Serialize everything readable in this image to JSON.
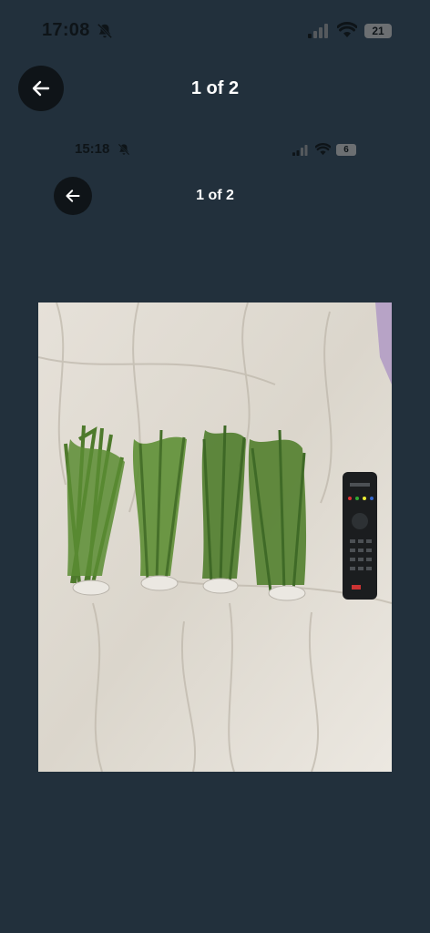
{
  "status_bar": {
    "time": "17:08",
    "battery": "21"
  },
  "header": {
    "page_counter": "1 of 2"
  },
  "inner_screenshot": {
    "status_bar": {
      "time": "15:18",
      "battery": "6"
    },
    "page_counter": "1 of 2"
  },
  "icons": {
    "back": "arrow-left-icon",
    "silent": "bell-slash-icon",
    "signal": "cellular-signal-icon",
    "wifi": "wifi-icon",
    "battery": "battery-icon"
  },
  "colors": {
    "background": "#22303c",
    "button": "#0f1418",
    "text": "#ffffff"
  }
}
